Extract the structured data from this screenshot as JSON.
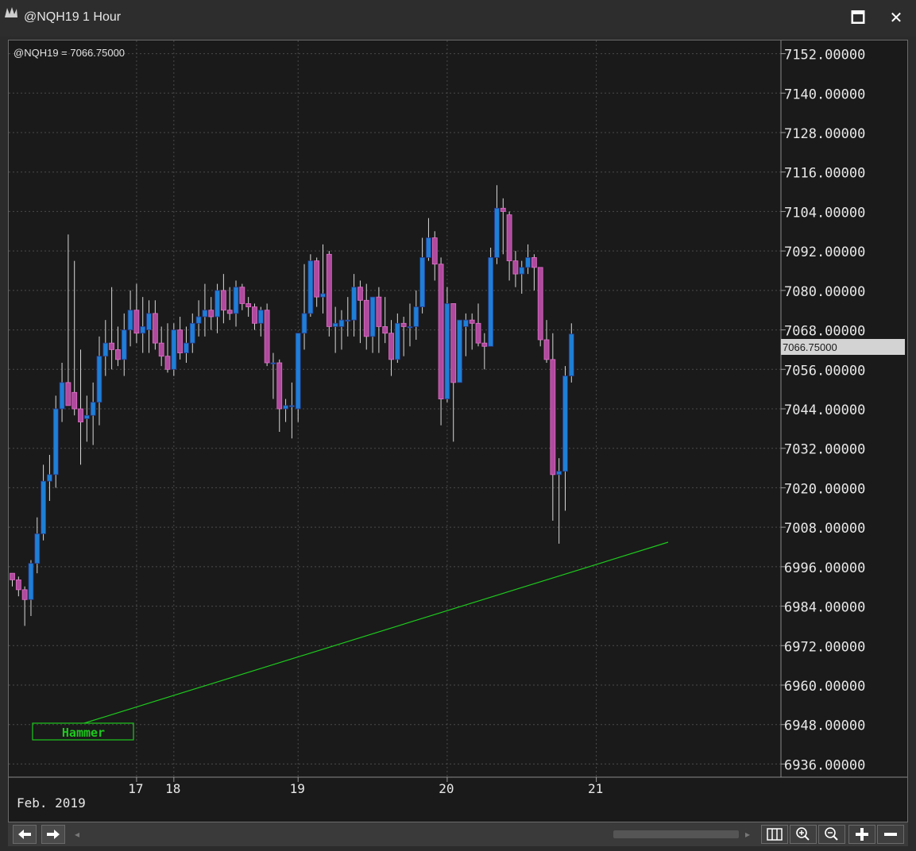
{
  "window": {
    "title": "@NQH19 1 Hour",
    "maximize_glyph": "🗖",
    "close_glyph": "✕"
  },
  "chart_header": "@NQH19 = 7066.75000",
  "price_marker": "7066.75000",
  "annotation": "Hammer",
  "colors": {
    "up_body": "#1e7fd6",
    "down_body": "#b04a9e",
    "wick": "#d8d8d8",
    "grid": "#4a4a4a",
    "trendline": "#1ec81e",
    "price_marker_bg": "#d3d3d3"
  },
  "chart_data": {
    "type": "candlestick",
    "ylim": [
      6932,
      7156
    ],
    "yticks": [
      "7152.00000",
      "7140.00000",
      "7128.00000",
      "7116.00000",
      "7104.00000",
      "7092.00000",
      "7080.00000",
      "7068.00000",
      "7056.00000",
      "7044.00000",
      "7032.00000",
      "7020.00000",
      "7008.00000",
      "6996.00000",
      "6984.00000",
      "6972.00000",
      "6960.00000",
      "6948.00000",
      "6936.00000"
    ],
    "ytick_values": [
      7152,
      7140,
      7128,
      7116,
      7104,
      7092,
      7080,
      7068,
      7056,
      7044,
      7032,
      7020,
      7008,
      6996,
      6984,
      6972,
      6960,
      6948,
      6936
    ],
    "xticks": [
      {
        "label": "17",
        "bar": 20
      },
      {
        "label": "18",
        "bar": 26
      },
      {
        "label": "19",
        "bar": 46
      },
      {
        "label": "20",
        "bar": 70
      },
      {
        "label": "21",
        "bar": 94
      }
    ],
    "xaxis_caption": "Feb. 2019",
    "candles": [
      [
        6994,
        6994,
        6990,
        6992
      ],
      [
        6992,
        6993,
        6987,
        6989
      ],
      [
        6989,
        6990,
        6978,
        6986
      ],
      [
        6986,
        6998,
        6981,
        6997
      ],
      [
        6997,
        7011,
        6994,
        7006
      ],
      [
        7006,
        7027,
        7004,
        7022
      ],
      [
        7022,
        7030,
        7016,
        7024
      ],
      [
        7024,
        7048,
        7020,
        7044
      ],
      [
        7044,
        7058,
        7040,
        7052
      ],
      [
        7052,
        7097,
        7045,
        7045
      ],
      [
        7049,
        7089,
        7042,
        7044
      ],
      [
        7044,
        7062,
        7027,
        7040
      ],
      [
        7041,
        7048,
        7034,
        7042
      ],
      [
        7042,
        7052,
        7033,
        7046
      ],
      [
        7046,
        7066,
        7039,
        7060
      ],
      [
        7060,
        7071,
        7054,
        7064
      ],
      [
        7064,
        7081,
        7056,
        7062
      ],
      [
        7062,
        7069,
        7057,
        7059
      ],
      [
        7059,
        7073,
        7054,
        7068
      ],
      [
        7068,
        7080,
        7063,
        7074
      ],
      [
        7074,
        7082,
        7064,
        7067
      ],
      [
        7067,
        7078,
        7061,
        7069
      ],
      [
        7068,
        7077,
        7061,
        7073
      ],
      [
        7073,
        7077,
        7062,
        7064
      ],
      [
        7064,
        7069,
        7057,
        7060
      ],
      [
        7060,
        7070,
        7055,
        7056
      ],
      [
        7056,
        7070,
        7054,
        7068
      ],
      [
        7068,
        7072,
        7059,
        7061
      ],
      [
        7061,
        7069,
        7058,
        7064
      ],
      [
        7064,
        7073,
        7061,
        7070
      ],
      [
        7070,
        7077,
        7066,
        7072
      ],
      [
        7072,
        7082,
        7066,
        7074
      ],
      [
        7074,
        7078,
        7068,
        7072
      ],
      [
        7072,
        7082,
        7067,
        7080
      ],
      [
        7080,
        7085,
        7070,
        7074
      ],
      [
        7074,
        7081,
        7071,
        7073
      ],
      [
        7073,
        7083,
        7069,
        7081
      ],
      [
        7081,
        7082,
        7074,
        7076
      ],
      [
        7076,
        7078,
        7072,
        7075
      ],
      [
        7075,
        7076,
        7068,
        7070
      ],
      [
        7070,
        7075,
        7066,
        7074
      ],
      [
        7074,
        7076,
        7057,
        7058
      ],
      [
        7058,
        7061,
        7047,
        7058
      ],
      [
        7058,
        7059,
        7037,
        7044
      ],
      [
        7044,
        7047,
        7040,
        7045
      ],
      [
        7045,
        7052,
        7035,
        7045
      ],
      [
        7044,
        7066,
        7040,
        7067
      ],
      [
        7067,
        7088,
        7062,
        7073
      ],
      [
        7073,
        7091,
        7072,
        7089
      ],
      [
        7089,
        7090,
        7075,
        7078
      ],
      [
        7078,
        7094,
        7073,
        7079
      ],
      [
        7091,
        7092,
        7066,
        7069
      ],
      [
        7069,
        7075,
        7061,
        7070
      ],
      [
        7069,
        7074,
        7062,
        7071
      ],
      [
        7071,
        7078,
        7066,
        7071
      ],
      [
        7071,
        7085,
        7066,
        7081
      ],
      [
        7081,
        7083,
        7064,
        7077
      ],
      [
        7077,
        7082,
        7062,
        7066
      ],
      [
        7066,
        7076,
        7061,
        7078
      ],
      [
        7078,
        7081,
        7061,
        7069
      ],
      [
        7069,
        7078,
        7064,
        7067
      ],
      [
        7067,
        7071,
        7054,
        7059
      ],
      [
        7059,
        7073,
        7058,
        7070
      ],
      [
        7070,
        7072,
        7060,
        7069
      ],
      [
        7069,
        7076,
        7063,
        7069
      ],
      [
        7069,
        7080,
        7065,
        7075
      ],
      [
        7075,
        7096,
        7073,
        7090
      ],
      [
        7090,
        7102,
        7089,
        7096
      ],
      [
        7096,
        7098,
        7083,
        7088
      ],
      [
        7088,
        7090,
        7039,
        7047
      ],
      [
        7047,
        7081,
        7046,
        7076
      ],
      [
        7076,
        7076,
        7034,
        7052
      ],
      [
        7052,
        7071,
        7058,
        7071
      ],
      [
        7069,
        7073,
        7060,
        7071
      ],
      [
        7071,
        7073,
        7062,
        7070
      ],
      [
        7070,
        7076,
        7063,
        7064
      ],
      [
        7064,
        7067,
        7056,
        7063
      ],
      [
        7063,
        7093,
        7063,
        7090
      ],
      [
        7090,
        7112,
        7088,
        7105
      ],
      [
        7105,
        7108,
        7091,
        7104
      ],
      [
        7103,
        7104,
        7083,
        7089
      ],
      [
        7089,
        7092,
        7081,
        7085
      ],
      [
        7085,
        7089,
        7079,
        7087
      ],
      [
        7087,
        7094,
        7085,
        7090
      ],
      [
        7090,
        7091,
        7080,
        7087
      ],
      [
        7087,
        7087,
        7063,
        7065
      ],
      [
        7065,
        7071,
        7058,
        7059
      ],
      [
        7059,
        7067,
        7010,
        7024
      ],
      [
        7024,
        7029,
        7003,
        7025
      ],
      [
        7025,
        7057,
        7013,
        7054
      ],
      [
        7054,
        7070,
        7052,
        7066.75
      ]
    ]
  }
}
